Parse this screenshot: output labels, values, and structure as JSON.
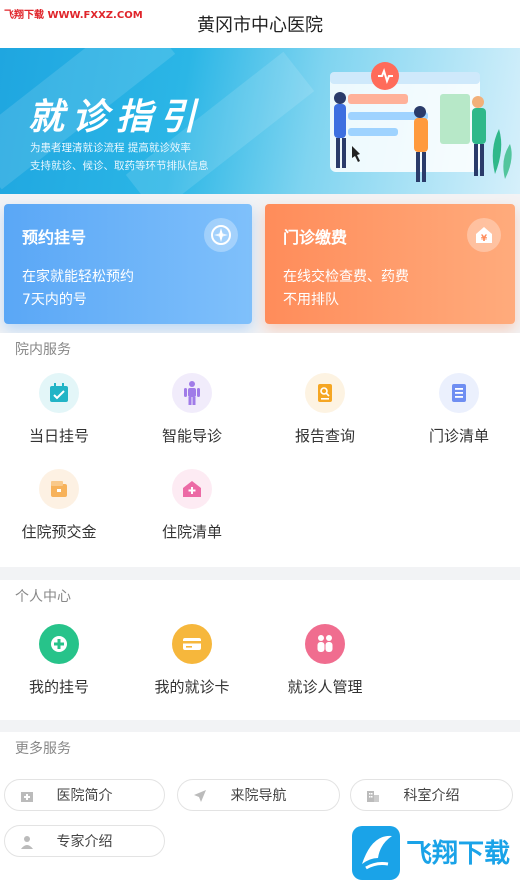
{
  "watermark": "飞翔下载 WWW.FXXZ.COM",
  "header": {
    "title": "黄冈市中心医院"
  },
  "banner": {
    "title": "就诊指引",
    "sub1": "为患者理清就诊流程 提高就诊效率",
    "sub2": "支持就诊、候诊、取药等环节排队信息"
  },
  "cards": [
    {
      "title": "预约挂号",
      "line1": "在家就能轻松预约",
      "line2": "7天内的号",
      "icon": "compass-icon"
    },
    {
      "title": "门诊缴费",
      "line1": "在线交检查费、药费",
      "line2": "不用排队",
      "icon": "yuan-house-icon"
    }
  ],
  "hospital_services": {
    "title": "院内服务",
    "items": [
      {
        "label": "当日挂号",
        "icon": "calendar-check-icon",
        "color": "#22b4c6"
      },
      {
        "label": "智能导诊",
        "icon": "human-body-icon",
        "color": "#a07be8"
      },
      {
        "label": "报告查询",
        "icon": "report-search-icon",
        "color": "#f5a623"
      },
      {
        "label": "门诊清单",
        "icon": "list-icon",
        "color": "#6f8ef2"
      },
      {
        "label": "住院预交金",
        "icon": "wallet-icon",
        "color": "#f7b25a"
      },
      {
        "label": "住院清单",
        "icon": "hospital-house-icon",
        "color": "#ec6aa5"
      }
    ]
  },
  "personal_center": {
    "title": "个人中心",
    "items": [
      {
        "label": "我的挂号",
        "icon": "plus-circle-icon",
        "color": "#27c38a"
      },
      {
        "label": "我的就诊卡",
        "icon": "card-icon",
        "color": "#f6b73c"
      },
      {
        "label": "就诊人管理",
        "icon": "family-icon",
        "color": "#f06d8f"
      }
    ]
  },
  "more_services": {
    "title": "更多服务",
    "items": [
      {
        "label": "医院简介",
        "icon": "hospital-icon"
      },
      {
        "label": "来院导航",
        "icon": "navigation-arrow-icon"
      },
      {
        "label": "科室介绍",
        "icon": "building-icon"
      },
      {
        "label": "专家介绍",
        "icon": "doctor-icon"
      }
    ]
  },
  "corner_logo": {
    "text": "飞翔下载"
  }
}
